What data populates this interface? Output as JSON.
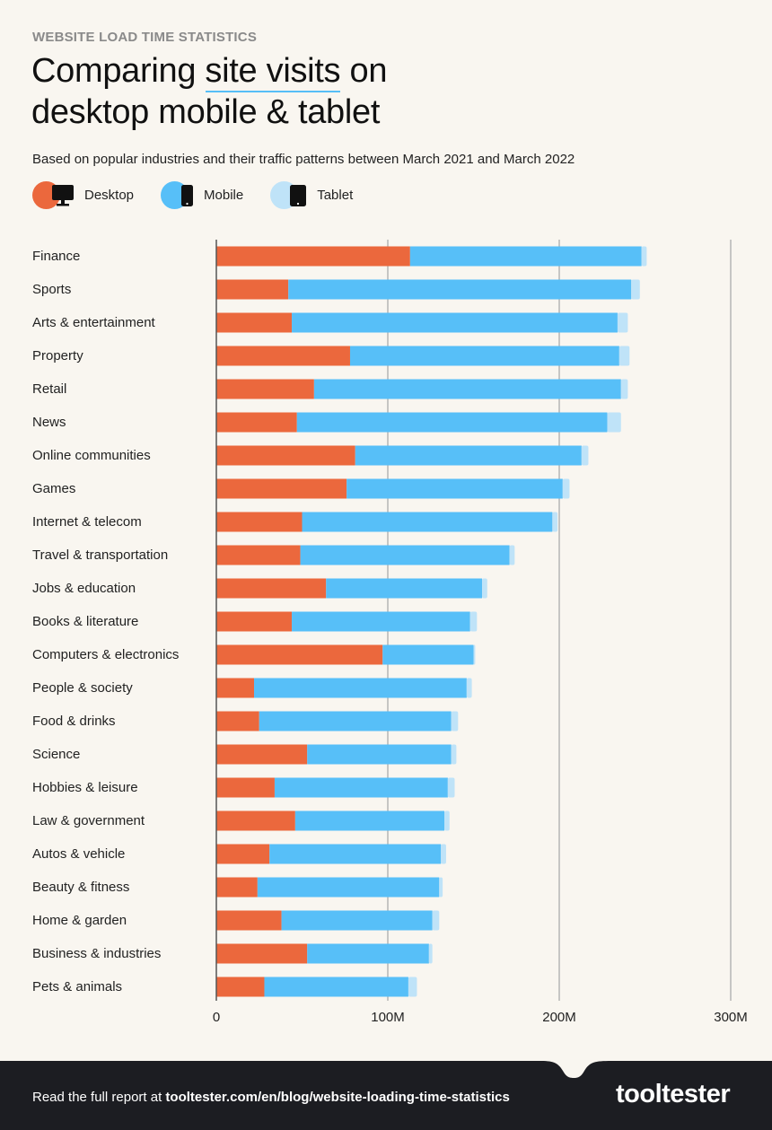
{
  "header": {
    "eyebrow": "WEBSITE LOAD TIME STATISTICS",
    "title_pre": "Comparing ",
    "title_highlight": "site visits",
    "title_post": " on",
    "title_line2": "desktop mobile & tablet",
    "subtitle": "Based on popular industries and their traffic patterns between March 2021 and March 2022"
  },
  "legend": [
    {
      "label": "Desktop",
      "icon": "desktop-monitor-icon",
      "color": "#eb683d"
    },
    {
      "label": "Mobile",
      "icon": "mobile-phone-icon",
      "color": "#57bff8"
    },
    {
      "label": "Tablet",
      "icon": "tablet-icon",
      "color": "#bfe3f8"
    }
  ],
  "colors": {
    "desktop": "#eb683d",
    "mobile": "#57bff8",
    "tablet": "#bfe3f8",
    "gridline": "#b5b5b5",
    "axis": "#555555",
    "background": "#f9f6f0",
    "footer_bg": "#1c1d22"
  },
  "chart_data": {
    "type": "bar",
    "orientation": "horizontal",
    "stacked": true,
    "title": "Comparing site visits on desktop mobile & tablet",
    "subtitle": "Based on popular industries and their traffic patterns between March 2021 and March 2022",
    "xlabel": "",
    "ylabel": "",
    "xlim": [
      0,
      300
    ],
    "units": "millions of visits",
    "x_ticks": [
      0,
      100,
      200,
      300
    ],
    "x_tick_labels": [
      "0",
      "100M",
      "200M",
      "300M"
    ],
    "grid": true,
    "legend_position": "top-left",
    "categories": [
      "Finance",
      "Sports",
      "Arts & entertainment",
      "Property",
      "Retail",
      "News",
      "Online communities",
      "Games",
      "Internet & telecom",
      "Travel & transportation",
      "Jobs & education",
      "Books & literature",
      "Computers & electronics",
      "People & society",
      "Food & drinks",
      "Science",
      "Hobbies & leisure",
      "Law & government",
      "Autos & vehicle",
      "Beauty & fitness",
      "Home & garden",
      "Business & industries",
      "Pets & animals"
    ],
    "series": [
      {
        "name": "Desktop",
        "values": [
          113,
          42,
          44,
          78,
          57,
          47,
          81,
          76,
          50,
          49,
          64,
          44,
          97,
          22,
          25,
          53,
          34,
          46,
          31,
          24,
          38,
          53,
          28
        ]
      },
      {
        "name": "Mobile",
        "values": [
          135,
          200,
          190,
          157,
          179,
          181,
          132,
          126,
          146,
          122,
          91,
          104,
          53,
          124,
          112,
          84,
          101,
          87,
          100,
          106,
          88,
          71,
          84
        ]
      },
      {
        "name": "Tablet",
        "values": [
          3,
          5,
          6,
          6,
          4,
          8,
          4,
          4,
          3,
          3,
          3,
          4,
          1,
          3,
          4,
          3,
          4,
          3,
          3,
          2,
          4,
          2,
          5
        ]
      }
    ]
  },
  "footer": {
    "prefix": "Read the full report at ",
    "link": "tooltester.com/en/blog/website-loading-time-statistics",
    "logo": "tooltester"
  }
}
